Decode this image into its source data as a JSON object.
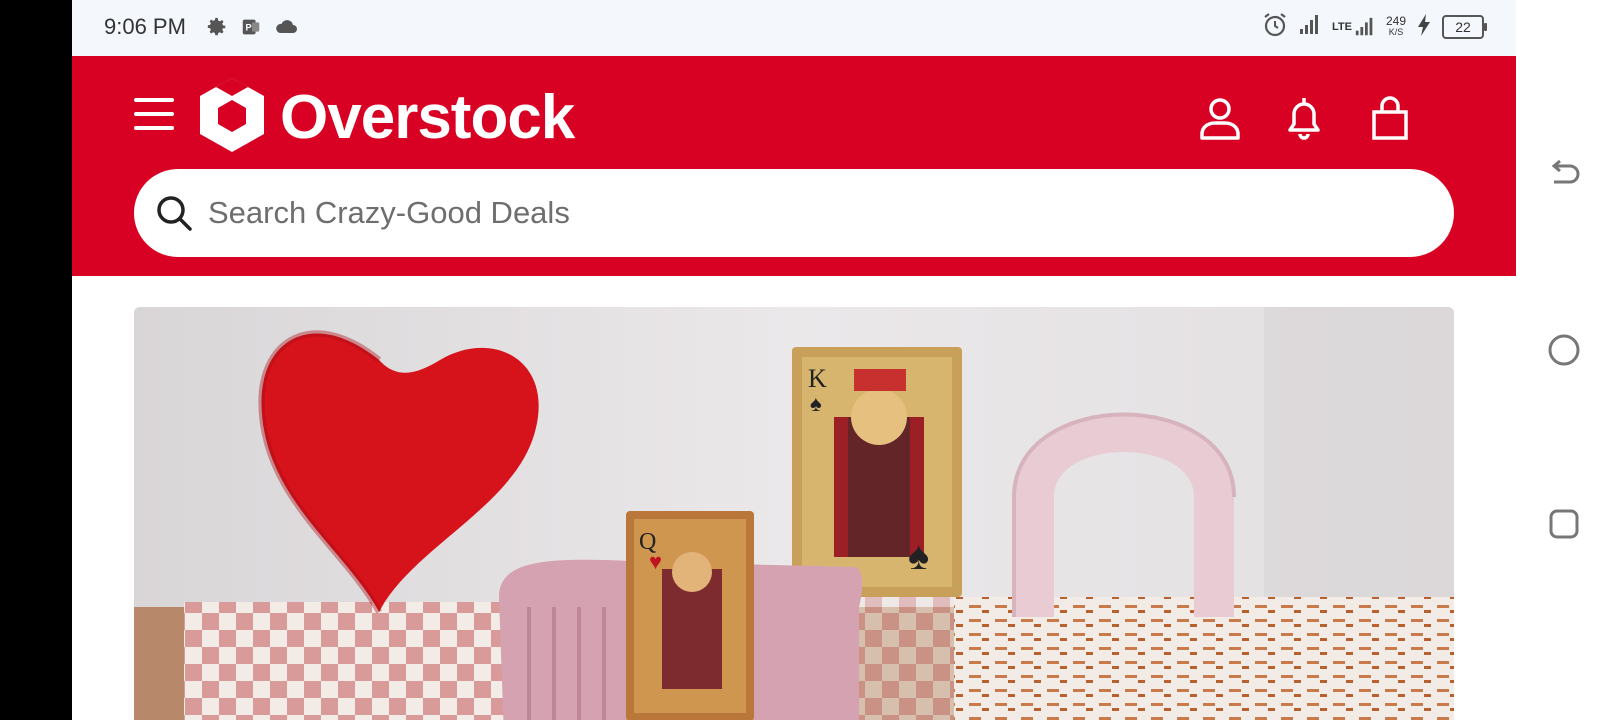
{
  "status_bar": {
    "time": "9:06 PM",
    "left_icons": [
      "settings-icon",
      "app-p-icon",
      "cloud-icon"
    ],
    "right_icons": [
      "alarm-icon",
      "signal-icon",
      "lte-signal-icon",
      "charging-icon"
    ],
    "network": "LTE",
    "speed_value": "249",
    "speed_unit": "K/S",
    "battery": "22"
  },
  "header": {
    "brand": "Overstock",
    "icons": [
      "menu-icon",
      "user-icon",
      "bell-icon",
      "bag-icon"
    ],
    "brand_color": "#d80023"
  },
  "search": {
    "placeholder": "Search Crazy-Good Deals",
    "value": ""
  },
  "hero": {
    "image": "heart-pillow-playing-card-decor"
  },
  "system_nav": {
    "buttons": [
      "back-icon",
      "home-icon",
      "recents-icon"
    ]
  }
}
